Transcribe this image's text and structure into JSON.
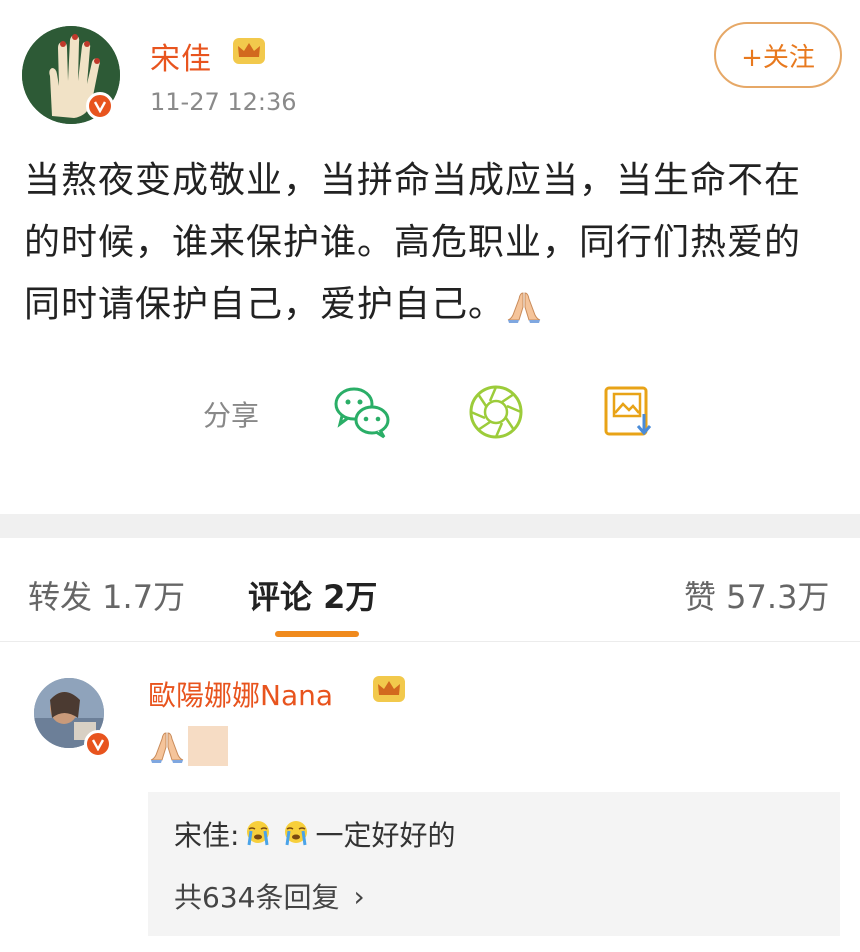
{
  "post": {
    "author": "宋佳",
    "time": "11-27 12:36",
    "follow_label": "+关注",
    "text_line1": "当熬夜变成敬业，当拼命当成应当，当生命不在",
    "text_line2": "的时候，谁来保护谁。高危职业，同行们热爱的",
    "text_line3": "同时请保护自己，爱护自己。",
    "share_label": "分享"
  },
  "tabs": {
    "repost": "转发 1.7万",
    "comments": "评论 2万",
    "likes": "赞 57.3万"
  },
  "comment": {
    "author": "歐陽娜娜Nana",
    "reply_author": "宋佳:",
    "reply_text": "一定好好的",
    "reply_count": "共634条回复",
    "reply_chevron": "›"
  },
  "colors": {
    "brand": "#e8541e",
    "accent": "#f08a1d",
    "wechat": "#2aae67",
    "moments": "#9ccc3a",
    "save": "#e8a317"
  },
  "icons": [
    "avatar-hand",
    "verified-badge",
    "crown-icon",
    "pray-emoji",
    "wechat-icon",
    "moments-icon",
    "save-image-icon",
    "crying-emoji",
    "chevron-right-icon"
  ]
}
